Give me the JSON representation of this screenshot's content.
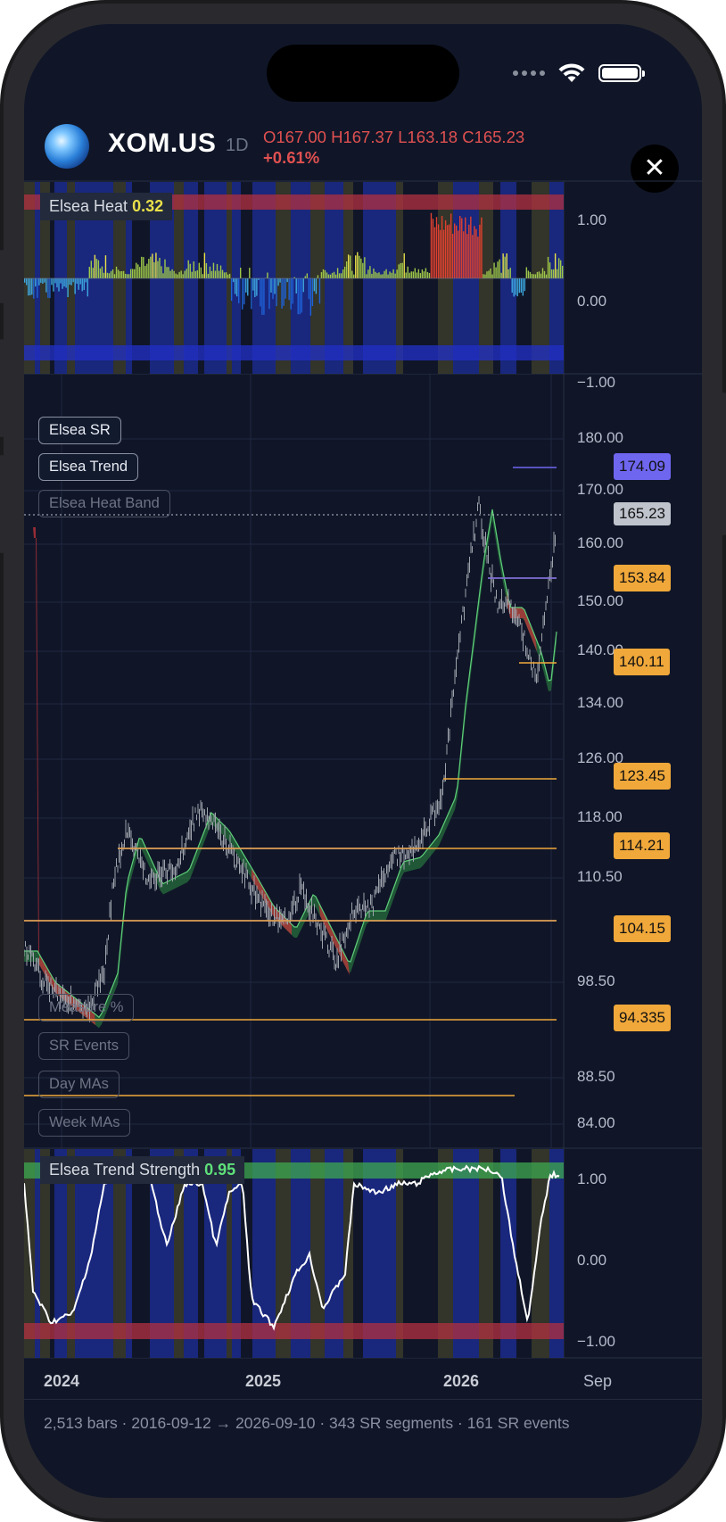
{
  "header": {
    "ticker": "XOM.US",
    "interval": "1D",
    "ohlc": "O167.00 H167.37 L163.18 C165.23",
    "change": "+0.61%",
    "close_icon": "close-icon",
    "logo_icon": "globe-logo-icon"
  },
  "status_bar": {
    "icons": [
      "cellular-dots-icon",
      "wifi-icon",
      "battery-icon"
    ]
  },
  "heat_panel": {
    "label": "Elsea Heat",
    "value": "0.32",
    "axis": [
      "1.00",
      "0.00",
      "−1.00"
    ]
  },
  "main_panel": {
    "toggles": [
      {
        "label": "Elsea SR",
        "active": true
      },
      {
        "label": "Elsea Trend",
        "active": true
      },
      {
        "label": "Elsea Heat Band",
        "active": false
      }
    ],
    "tools": [
      "Measure %",
      "SR Events",
      "Day MAs",
      "Week MAs"
    ],
    "axis": [
      "180.00",
      "170.00",
      "160.00",
      "150.00",
      "140.00",
      "134.00",
      "126.00",
      "118.00",
      "110.50",
      "98.50",
      "88.50",
      "84.00"
    ],
    "price_tags": [
      {
        "label": "174.09",
        "kind": "resistance"
      },
      {
        "label": "165.23",
        "kind": "last"
      },
      {
        "label": "153.84",
        "kind": "support"
      },
      {
        "label": "140.11",
        "kind": "support"
      },
      {
        "label": "123.45",
        "kind": "support"
      },
      {
        "label": "114.21",
        "kind": "support"
      },
      {
        "label": "104.15",
        "kind": "support"
      },
      {
        "label": "94.335",
        "kind": "support"
      }
    ]
  },
  "strength_panel": {
    "label": "Elsea Trend Strength",
    "value": "0.95",
    "axis": [
      "1.00",
      "0.00",
      "−1.00"
    ]
  },
  "x_axis": [
    "2024",
    "2025",
    "2026",
    "Sep"
  ],
  "footer": {
    "text": "2,513 bars · 2016-09-12 → 2026-09-10 · 343 SR segments · 161 SR events"
  },
  "colors": {
    "background": "#101628",
    "up": "#2fa84f",
    "down": "#c0343a",
    "support": "#f0a83a",
    "resistance": "#6f66f0",
    "heat_hot": "#e0412f",
    "heat_warm": "#e9e04a",
    "heat_cold": "#3da7e0"
  }
}
